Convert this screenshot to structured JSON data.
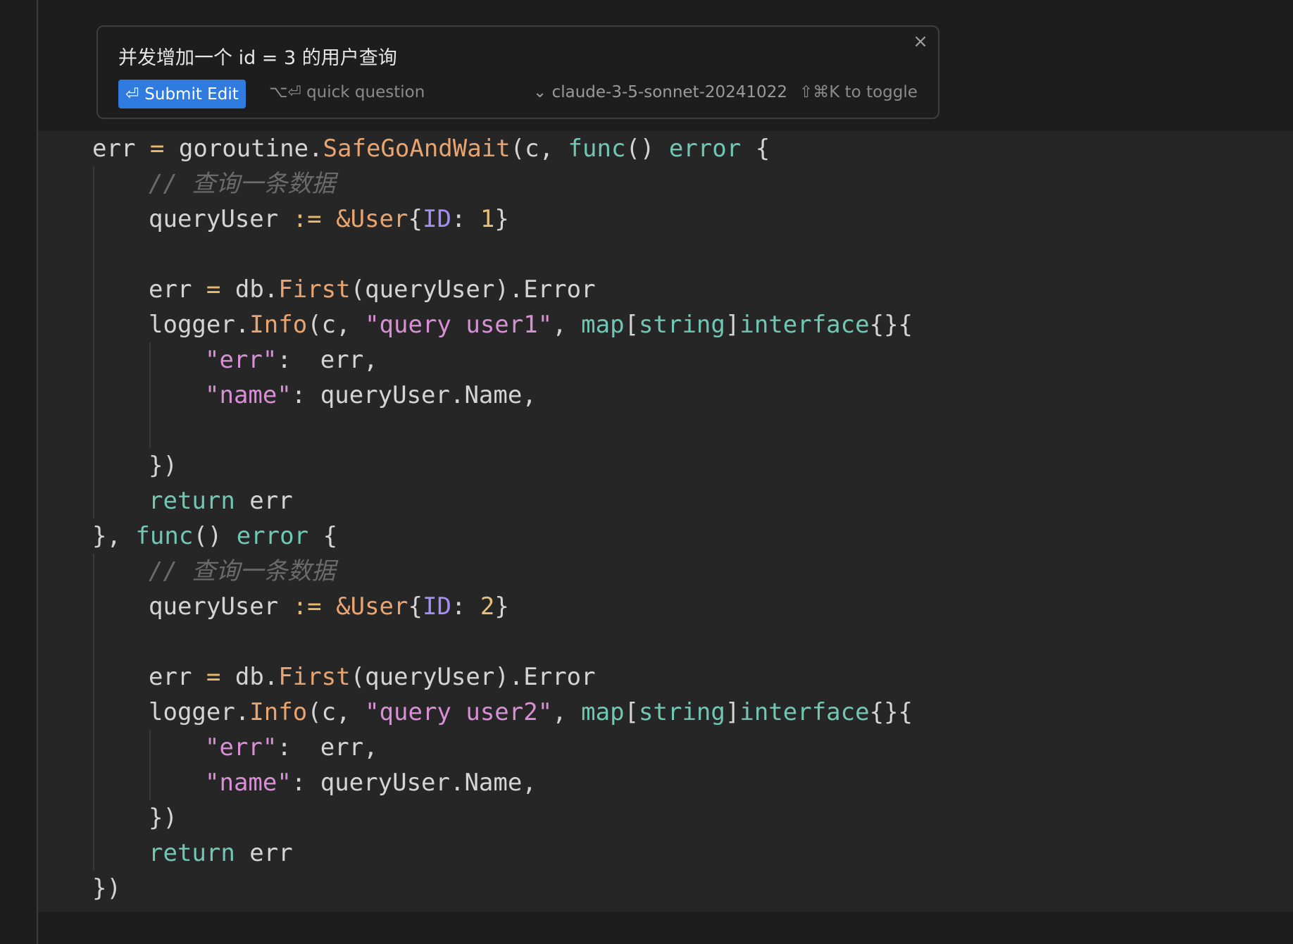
{
  "prompt": {
    "text": "并发增加一个 id = 3 的用户查询",
    "close_icon": "×",
    "submit_label": "Submit Edit",
    "submit_icon": "⏎",
    "quick_question": "⌥⏎ quick question",
    "model_chevron": "⌄",
    "model": "claude-3-5-sonnet-20241022",
    "toggle_hint": "⇧⌘K to toggle"
  },
  "code": {
    "lines": [
      [
        {
          "t": "err "
        },
        {
          "t": "=",
          "c": "op"
        },
        {
          "t": " goroutine."
        },
        {
          "t": "SafeGoAndWait",
          "c": "fn"
        },
        {
          "t": "(c, "
        },
        {
          "t": "func",
          "c": "kw"
        },
        {
          "t": "() "
        },
        {
          "t": "error",
          "c": "kw"
        },
        {
          "t": " {"
        }
      ],
      [
        {
          "t": "// 查询一条数据",
          "c": "cmt"
        }
      ],
      [
        {
          "t": "queryUser "
        },
        {
          "t": ":=",
          "c": "op"
        },
        {
          "t": " "
        },
        {
          "t": "&User",
          "c": "fn"
        },
        {
          "t": "{"
        },
        {
          "t": "ID",
          "c": "field"
        },
        {
          "t": ": "
        },
        {
          "t": "1",
          "c": "num"
        },
        {
          "t": "}"
        }
      ],
      [],
      [
        {
          "t": "err "
        },
        {
          "t": "=",
          "c": "op"
        },
        {
          "t": " db."
        },
        {
          "t": "First",
          "c": "fn"
        },
        {
          "t": "(queryUser).Error"
        }
      ],
      [
        {
          "t": "logger."
        },
        {
          "t": "Info",
          "c": "fn"
        },
        {
          "t": "(c, "
        },
        {
          "t": "\"query user1\"",
          "c": "str"
        },
        {
          "t": ", "
        },
        {
          "t": "map",
          "c": "kw"
        },
        {
          "t": "["
        },
        {
          "t": "string",
          "c": "kw"
        },
        {
          "t": "]"
        },
        {
          "t": "interface",
          "c": "kw"
        },
        {
          "t": "{}{"
        }
      ],
      [
        {
          "t": "\"err\"",
          "c": "str"
        },
        {
          "t": ":  err,"
        }
      ],
      [
        {
          "t": "\"name\"",
          "c": "str"
        },
        {
          "t": ": queryUser.Name,"
        }
      ],
      [],
      [
        {
          "t": "})"
        }
      ],
      [
        {
          "t": "return",
          "c": "kw"
        },
        {
          "t": " err"
        }
      ],
      [
        {
          "t": "}, "
        },
        {
          "t": "func",
          "c": "kw"
        },
        {
          "t": "() "
        },
        {
          "t": "error",
          "c": "kw"
        },
        {
          "t": " {"
        }
      ],
      [
        {
          "t": "// 查询一条数据",
          "c": "cmt"
        }
      ],
      [
        {
          "t": "queryUser "
        },
        {
          "t": ":=",
          "c": "op"
        },
        {
          "t": " "
        },
        {
          "t": "&User",
          "c": "fn"
        },
        {
          "t": "{"
        },
        {
          "t": "ID",
          "c": "field"
        },
        {
          "t": ": "
        },
        {
          "t": "2",
          "c": "num"
        },
        {
          "t": "}"
        }
      ],
      [],
      [
        {
          "t": "err "
        },
        {
          "t": "=",
          "c": "op"
        },
        {
          "t": " db."
        },
        {
          "t": "First",
          "c": "fn"
        },
        {
          "t": "(queryUser).Error"
        }
      ],
      [
        {
          "t": "logger."
        },
        {
          "t": "Info",
          "c": "fn"
        },
        {
          "t": "(c, "
        },
        {
          "t": "\"query user2\"",
          "c": "str"
        },
        {
          "t": ", "
        },
        {
          "t": "map",
          "c": "kw"
        },
        {
          "t": "["
        },
        {
          "t": "string",
          "c": "kw"
        },
        {
          "t": "]"
        },
        {
          "t": "interface",
          "c": "kw"
        },
        {
          "t": "{}{"
        }
      ],
      [
        {
          "t": "\"err\"",
          "c": "str"
        },
        {
          "t": ":  err,"
        }
      ],
      [
        {
          "t": "\"name\"",
          "c": "str"
        },
        {
          "t": ": queryUser.Name,"
        }
      ],
      [
        {
          "t": "})"
        }
      ],
      [
        {
          "t": "return",
          "c": "kw"
        },
        {
          "t": " err"
        }
      ],
      [
        {
          "t": "})"
        }
      ]
    ]
  }
}
